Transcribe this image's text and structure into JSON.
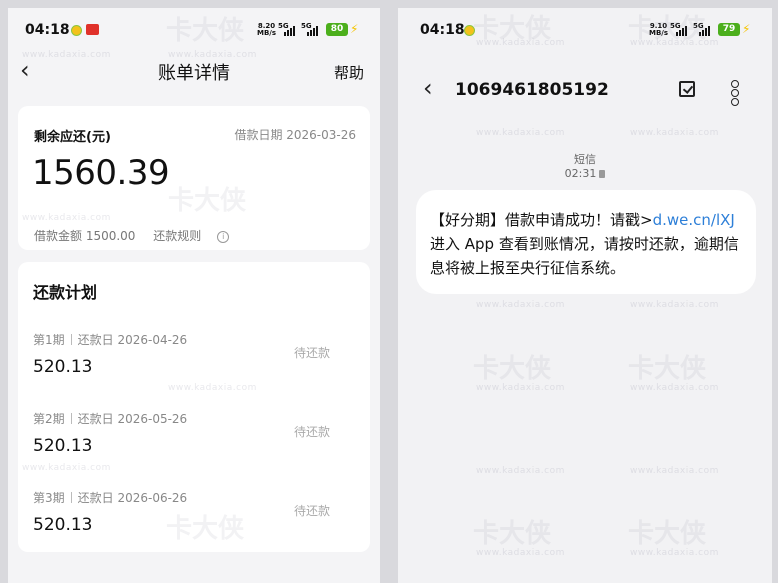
{
  "left": {
    "status": {
      "time": "04:18",
      "speed_value": "8.20",
      "speed_unit": "MB/s",
      "sig1": "5G",
      "sig2": "5G",
      "battery": "80"
    },
    "header": {
      "title": "账单详情",
      "help": "帮助"
    },
    "summary": {
      "remaining_label": "剩余应还(元)",
      "loan_date_label": "借款日期 2026-03-26",
      "remaining_amount": "1560.39",
      "loan_amount": "借款金额 1500.00",
      "rules": "还款规则"
    },
    "plan": {
      "title": "还款计划",
      "installments": [
        {
          "period": "第1期",
          "due": "还款日 2026-04-26",
          "amount": "520.13",
          "state": "待还款"
        },
        {
          "period": "第2期",
          "due": "还款日 2026-05-26",
          "amount": "520.13",
          "state": "待还款"
        },
        {
          "period": "第3期",
          "due": "还款日 2026-06-26",
          "amount": "520.13",
          "state": "待还款"
        }
      ]
    }
  },
  "right": {
    "status": {
      "time": "04:18",
      "speed_value": "9.10",
      "speed_unit": "MB/s",
      "sig1": "5G",
      "sig2": "5G",
      "battery": "79"
    },
    "header": {
      "number": "1069461805192"
    },
    "message": {
      "kind": "短信",
      "time": "02:31",
      "text_before": "【好分期】借款申请成功！请戳>",
      "link": "d.we.cn/lXJ",
      "text_after": " 进入 App 查看到账情况，请按时还款，逾期信息将被上报至央行征信系统。"
    }
  },
  "watermark": {
    "text": "www.kadaxia.com",
    "brand": "卡大侠"
  }
}
